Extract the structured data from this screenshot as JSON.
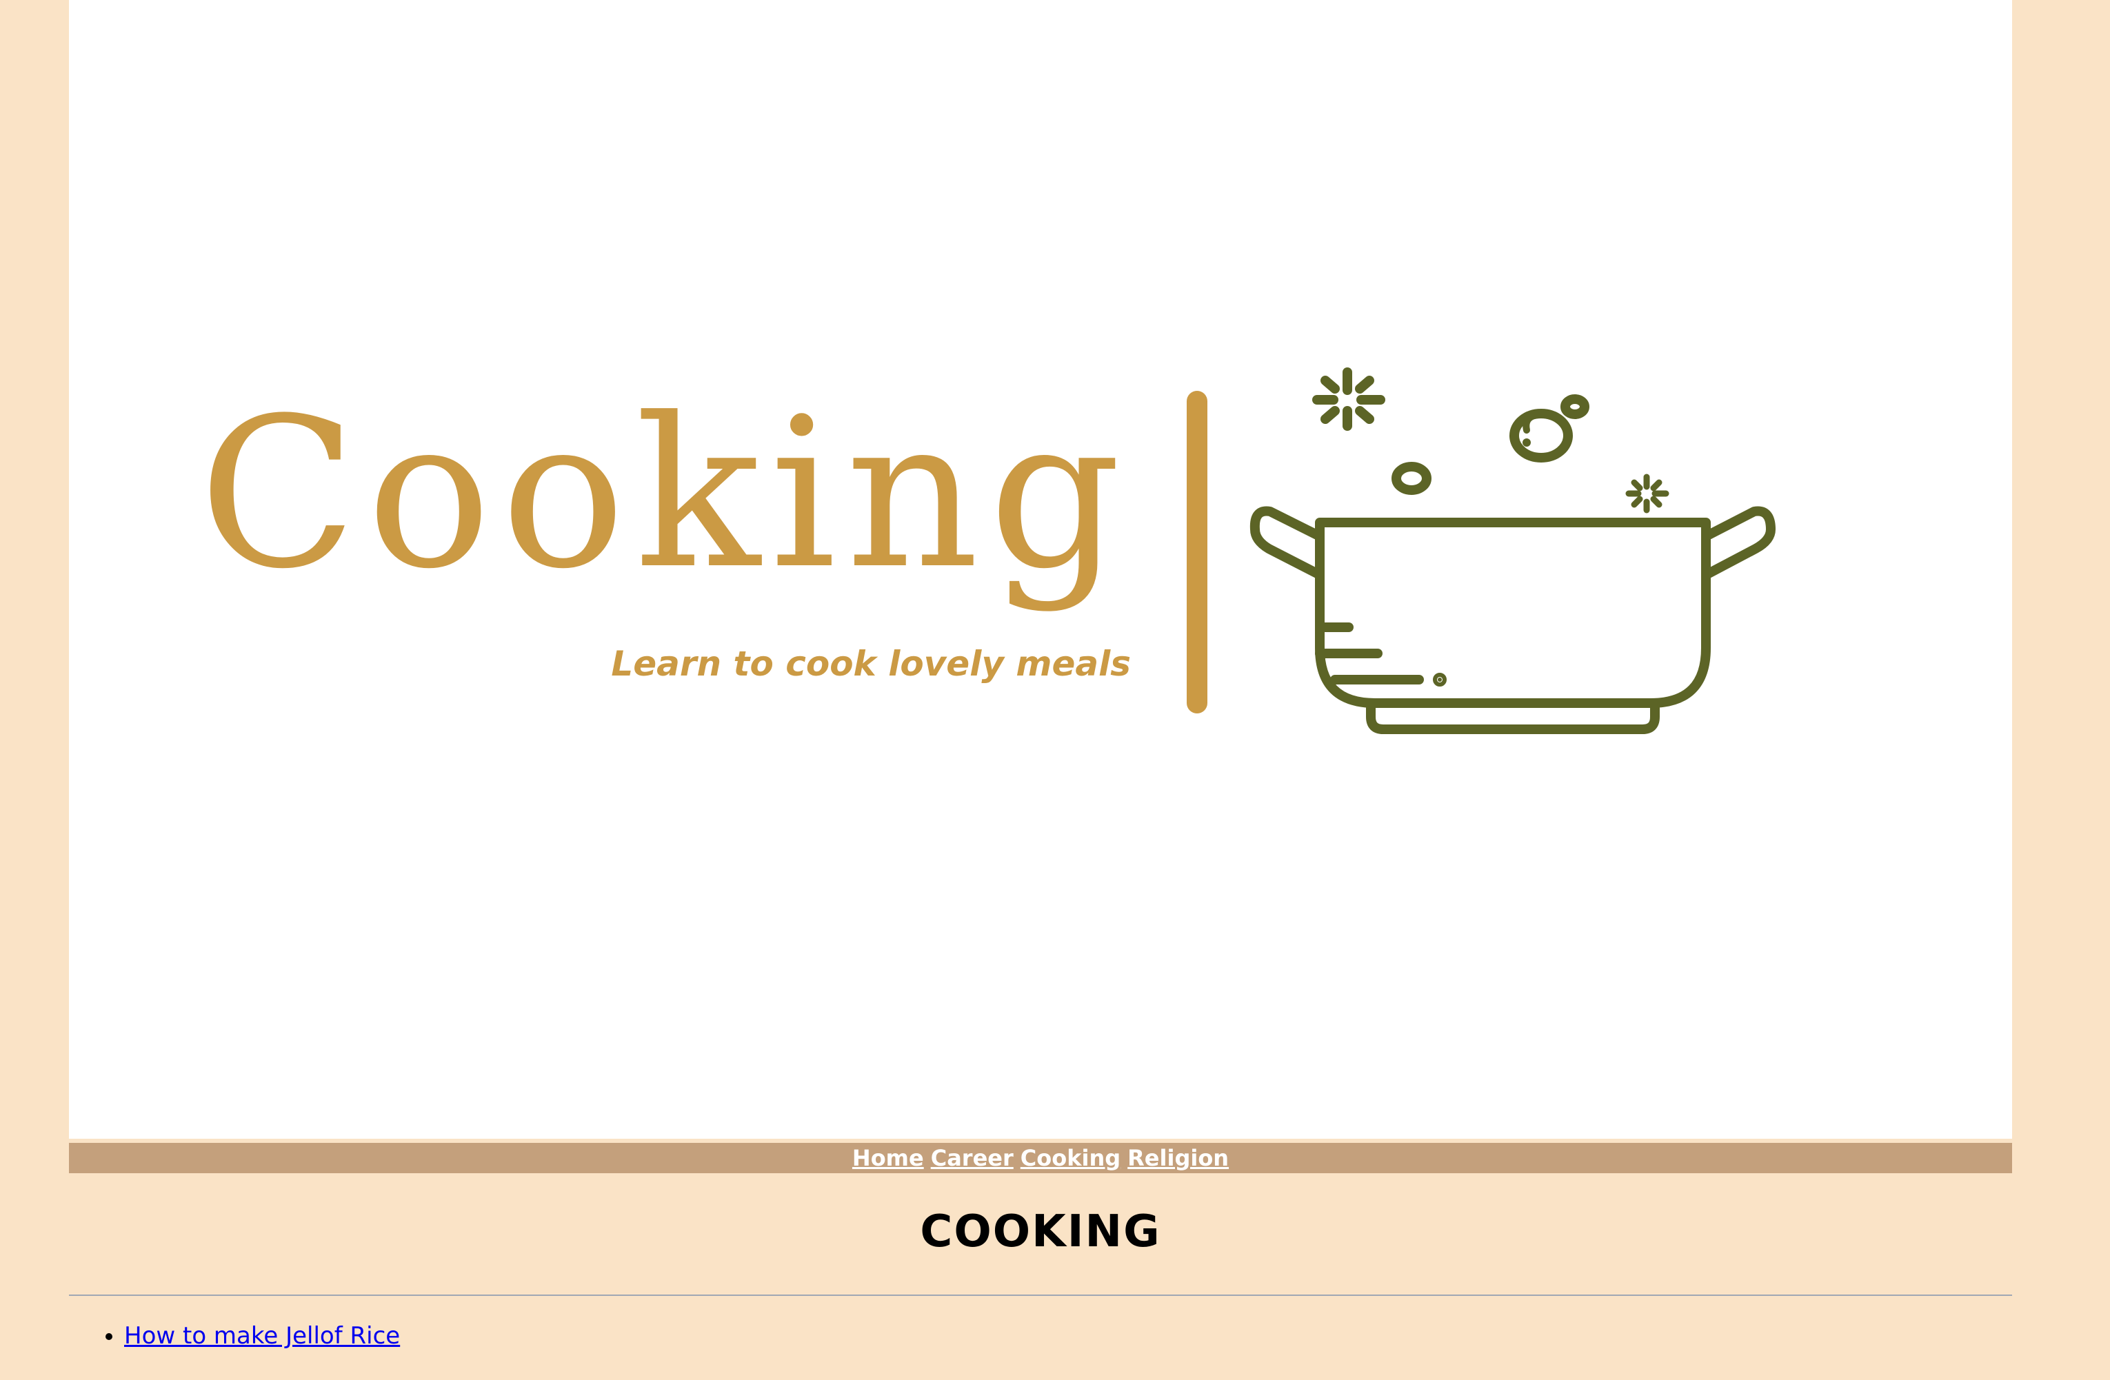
{
  "banner": {
    "logo_word": "Cooking",
    "tagline": "Learn to cook lovely meals",
    "accent_color": "#cb9a44",
    "pot_color": "#5c6426",
    "icon": "cooking-pot-icon"
  },
  "nav": {
    "items": [
      {
        "label": "Home"
      },
      {
        "label": "Career"
      },
      {
        "label": "Cooking"
      },
      {
        "label": "Religion"
      }
    ],
    "background": "#c4a07c"
  },
  "main": {
    "heading": "COOKING",
    "links": [
      {
        "label": "How to make Jellof Rice"
      }
    ]
  },
  "colors": {
    "page_background": "#fae3c6",
    "link": "#0000ee"
  }
}
